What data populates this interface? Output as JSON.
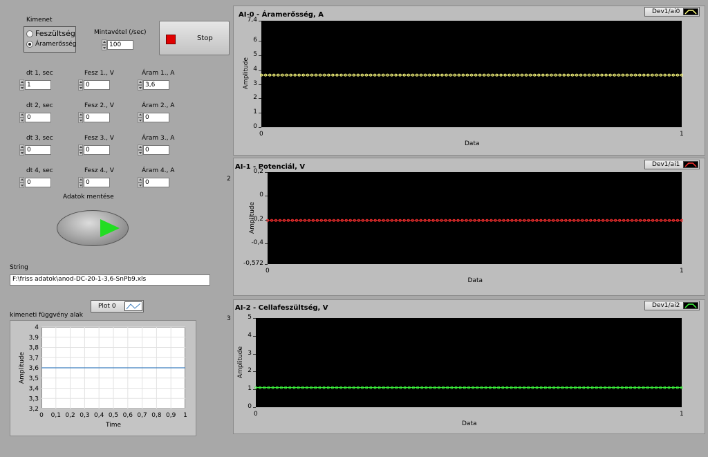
{
  "controls": {
    "output_label": "Kimenet",
    "output_options": [
      {
        "label": "Feszültség",
        "selected": false
      },
      {
        "label": "Áramerősség",
        "selected": true
      }
    ],
    "sampling_label": "Mintavétel (/sec)",
    "sampling_value": "100",
    "stop_label": "Stop",
    "rows": [
      {
        "dt_label": "dt 1, sec",
        "dt": "1",
        "fesz_label": "Fesz 1., V",
        "fesz": "0",
        "aram_label": "Áram 1., A",
        "aram": "3,6"
      },
      {
        "dt_label": "dt 2, sec",
        "dt": "0",
        "fesz_label": "Fesz 2., V",
        "fesz": "0",
        "aram_label": "Áram 2., A",
        "aram": "0"
      },
      {
        "dt_label": "dt 3, sec",
        "dt": "0",
        "fesz_label": "Fesz 3., V",
        "fesz": "0",
        "aram_label": "Áram 3., A",
        "aram": "0"
      },
      {
        "dt_label": "dt 4, sec",
        "dt": "0",
        "fesz_label": "Fesz 4., V",
        "fesz": "0",
        "aram_label": "Áram 4., A",
        "aram": "0"
      }
    ],
    "save_label": "Adatok mentése",
    "string_label": "String",
    "string_value": "F:\\friss adatok\\anod-DC-20-1-3,6-SnPb9.xls"
  },
  "output_graph": {
    "title": "kimeneti függvény alak",
    "legend": "Plot 0",
    "xlabel": "Time",
    "ylabel": "Amplitude",
    "xticks": [
      "0",
      "0,1",
      "0,2",
      "0,3",
      "0,4",
      "0,5",
      "0,6",
      "0,7",
      "0,8",
      "0,9",
      "1"
    ],
    "yticks": [
      "4",
      "3,9",
      "3,8",
      "3,7",
      "3,6",
      "3,5",
      "3,4",
      "3,3",
      "3,2"
    ],
    "value": 3.6,
    "ylim": [
      3.2,
      4
    ],
    "line_color": "#3f7fbf"
  },
  "graphs": [
    {
      "title": "AI-0 - Áramerősség, A",
      "legend": "Dev1/ai0",
      "xlabel": "Data",
      "ylabel": "Amplitude",
      "xticks": [
        "0",
        "1"
      ],
      "yticks": [
        "7,4",
        "6",
        "5",
        "4",
        "3",
        "2",
        "1",
        "0"
      ],
      "side_label": "",
      "value": 3.62,
      "ylim": [
        0,
        7.4
      ],
      "color": "#ffff80"
    },
    {
      "title": "AI-1 - Potenciál, V",
      "legend": "Dev1/ai1",
      "xlabel": "Data",
      "ylabel": "Amplitude",
      "xticks": [
        "0",
        "1"
      ],
      "yticks": [
        "0,2",
        "0",
        "-0,2",
        "-0,4",
        "-0,572"
      ],
      "side_label": "2",
      "value": -0.205,
      "ylim": [
        -0.572,
        0.2
      ],
      "color": "#ff3030"
    },
    {
      "title": "AI-2 - Cellafeszültség, V",
      "legend": "Dev1/ai2",
      "xlabel": "Data",
      "ylabel": "Amplitude",
      "xticks": [
        "0",
        "1"
      ],
      "yticks": [
        "5",
        "4",
        "3",
        "2",
        "1",
        "0"
      ],
      "side_label": "3",
      "value": 1.1,
      "ylim": [
        0,
        5
      ],
      "color": "#40ff40"
    }
  ]
}
